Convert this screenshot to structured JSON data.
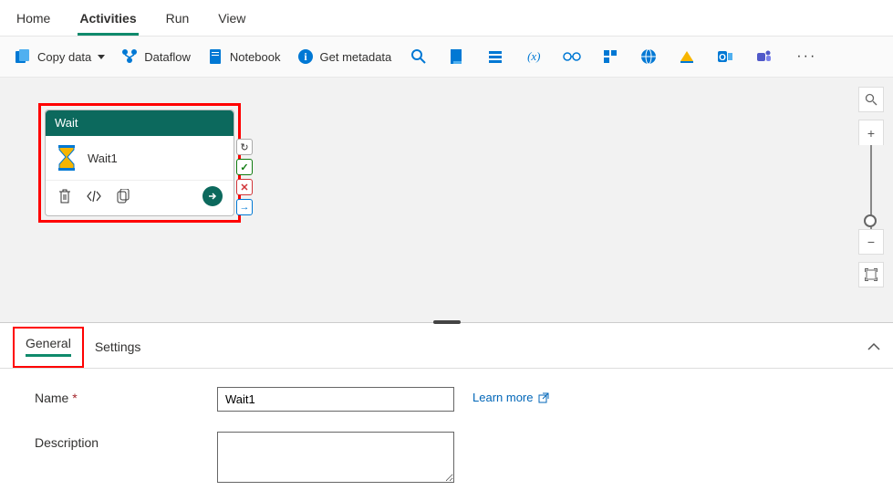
{
  "tabs": [
    "Home",
    "Activities",
    "Run",
    "View"
  ],
  "activeTab": 1,
  "toolbar": {
    "copyData": "Copy data",
    "dataflow": "Dataflow",
    "notebook": "Notebook",
    "getMetadata": "Get metadata"
  },
  "activity": {
    "type": "Wait",
    "name": "Wait1"
  },
  "panelTabs": {
    "general": "General",
    "settings": "Settings"
  },
  "fields": {
    "nameLabel": "Name",
    "nameValue": "Wait1",
    "descLabel": "Description",
    "descValue": "",
    "learnMore": "Learn more"
  }
}
